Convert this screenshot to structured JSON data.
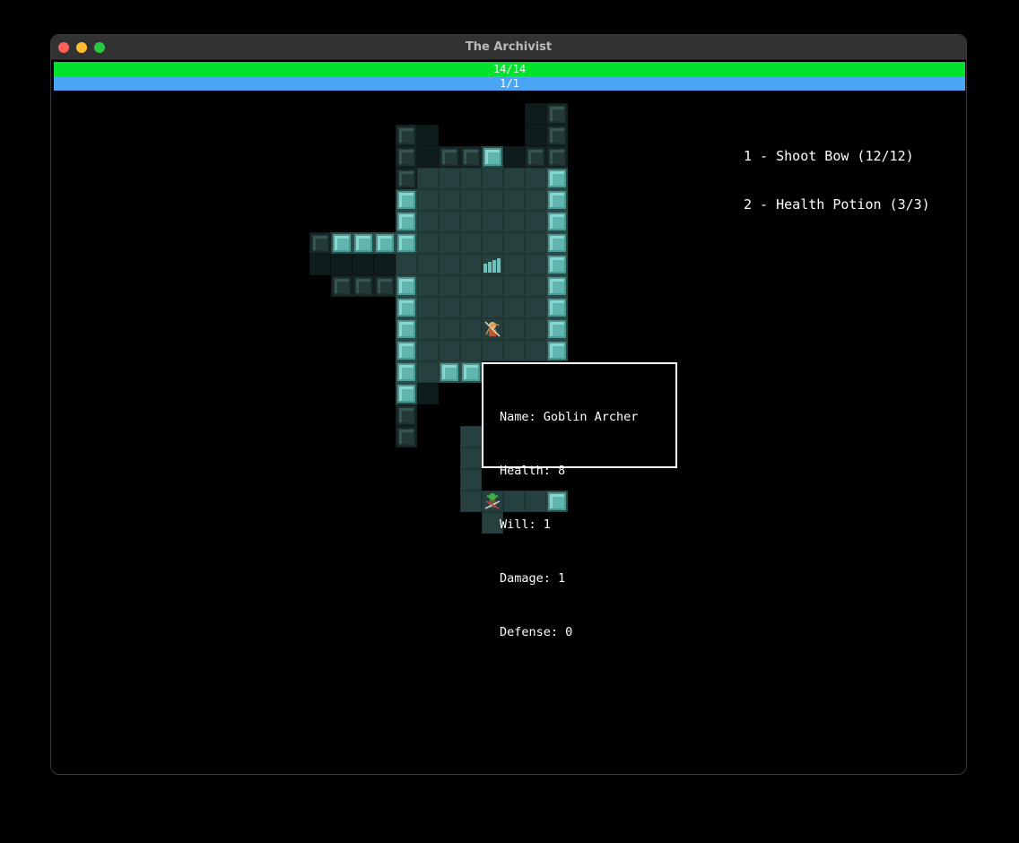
{
  "window": {
    "title": "The Archivist"
  },
  "status": {
    "health_text": "14/14",
    "health_fraction": 1.0,
    "health_color": "#00e22c",
    "will_text": "1/1",
    "will_fraction": 1.0,
    "will_color": "#4aa6f2"
  },
  "hotbar": {
    "items": [
      {
        "text": "1 - Shoot Bow (12/12)"
      },
      {
        "text": "2 - Health Potion (3/3)"
      }
    ]
  },
  "tooltip": {
    "name_line": "Name: Goblin Archer",
    "health_line": "Health: 8",
    "will_line": "Will: 1",
    "damage_line": "Damage: 1",
    "defense_line": "Defense: 0"
  },
  "entities": {
    "player_icon": "archer-hero-icon",
    "enemy_icon": "goblin-archer-icon",
    "stairs_icon": "stairs-icon"
  }
}
